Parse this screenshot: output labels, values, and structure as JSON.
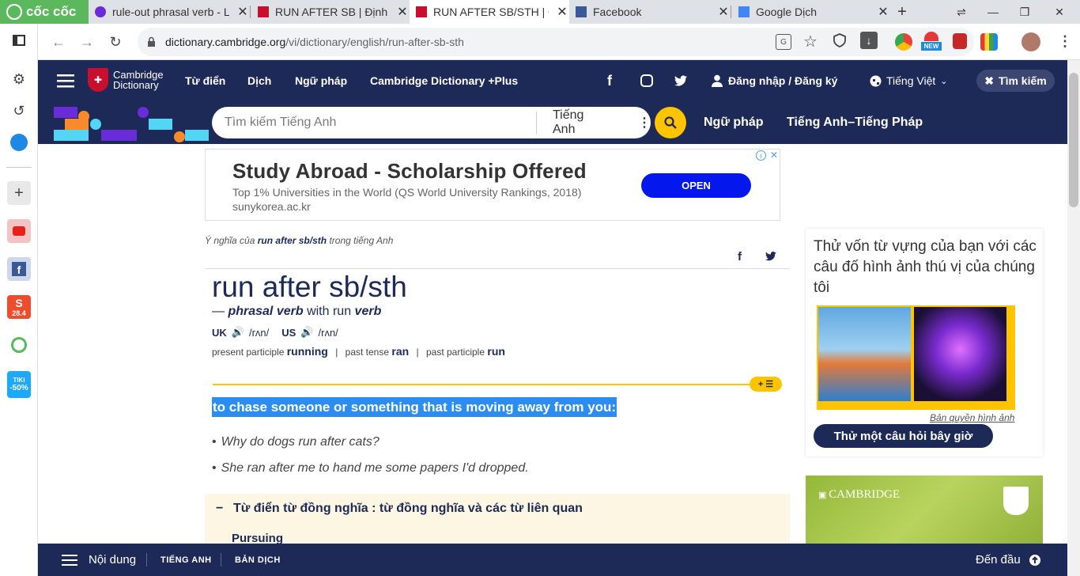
{
  "browser": {
    "brand": "cốc cốc",
    "tabs": [
      {
        "title": "rule-out phrasal verb - L",
        "active": false
      },
      {
        "title": "RUN AFTER SB | Định ng",
        "active": false
      },
      {
        "title": "RUN AFTER SB/STH | Đị",
        "active": true
      },
      {
        "title": "Facebook",
        "active": false
      },
      {
        "title": "Google Dịch",
        "active": false
      }
    ],
    "url_host": "dictionary.cambridge.org",
    "url_path": "/vi/dictionary/english/run-after-sb-sth",
    "ext_new_badge": "NEW",
    "tiki_label": "TIKI",
    "tiki_discount": "-50%",
    "shopee_badge": "28.4"
  },
  "header": {
    "logo_line1": "Cambridge",
    "logo_line2": "Dictionary",
    "nav": [
      "Từ điển",
      "Dịch",
      "Ngữ pháp",
      "Cambridge Dictionary +Plus"
    ],
    "login": "Đăng nhập / Đăng ký",
    "language": "Tiếng Việt",
    "search_btn": "Tìm kiếm"
  },
  "search": {
    "placeholder": "Tìm kiếm Tiếng Anh",
    "dict_select": "Tiếng Anh",
    "link1": "Ngữ pháp",
    "link2": "Tiếng Anh–Tiếng Pháp"
  },
  "ad": {
    "title": "Study Abroad - Scholarship Offered",
    "subtitle": "Top 1% Universities in the World (QS World University Rankings, 2018)",
    "url": "sunykorea.ac.kr",
    "open": "OPEN"
  },
  "entry": {
    "meaning_prefix": "Ý nghĩa của",
    "meaning_word": "run after sb/sth",
    "meaning_suffix": "trong tiếng Anh",
    "headword": "run after sb/sth",
    "dash": "—",
    "pos": "phrasal verb",
    "with": "with run",
    "pos2": "verb",
    "uk": "UK",
    "uk_ipa": "/rʌn/",
    "us": "US",
    "us_ipa": "/rʌn/",
    "forms": [
      {
        "label": "present participle",
        "value": "running"
      },
      {
        "label": "past tense",
        "value": "ran"
      },
      {
        "label": "past participle",
        "value": "run"
      }
    ],
    "definition": "to chase someone or something that is moving away from you:",
    "examples": [
      "Why do dogs run after cats?",
      "She ran after me to hand me some papers I'd dropped."
    ],
    "thesaurus_title": "Từ điển từ đồng nghĩa : từ đồng nghĩa và các từ liên quan",
    "thesaurus_word": "Pursuing"
  },
  "sidebar": {
    "quiz_text": "Thử vốn từ vựng của bạn với các câu đố hình ảnh thú vị của chúng tôi",
    "copyright": "Bản quyền hình ảnh",
    "quiz_btn": "Thử một câu hỏi bây giờ",
    "cam_label": "CAMBRIDGE"
  },
  "bottom": {
    "contents": "Nội dung",
    "tab1": "TIẾNG ANH",
    "tab2": "BẢN DỊCH",
    "top": "Đến đầu"
  }
}
